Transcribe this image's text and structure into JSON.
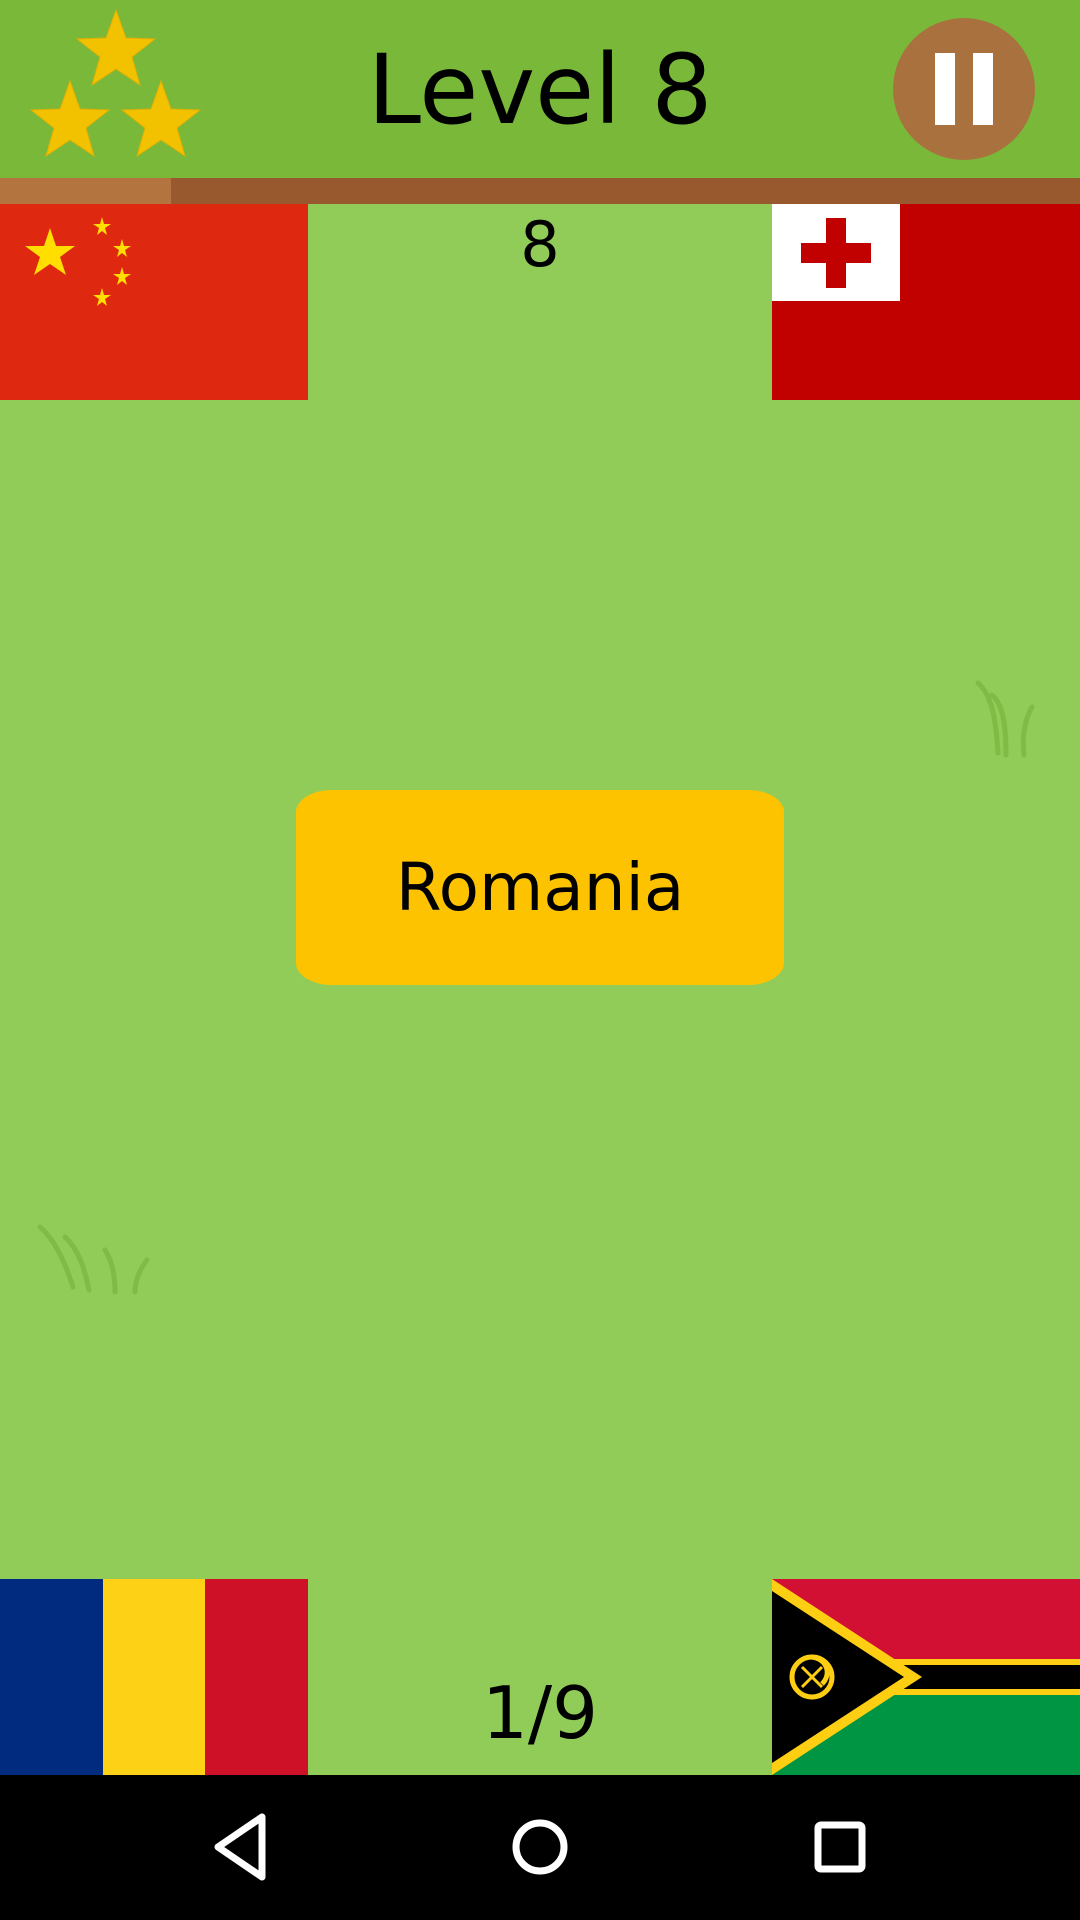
{
  "header": {
    "level_title": "Level 8",
    "stars_earned": 3,
    "star_color": "#f2c200",
    "pause_icon": "pause-icon"
  },
  "progress": {
    "fraction": 0.158,
    "track_color": "#98592e",
    "fill_color": "#b37440"
  },
  "game": {
    "score": "8",
    "question": "Romania",
    "counter": "1/9",
    "flags": [
      {
        "position": "top-left",
        "country_flag": "china-flag-icon"
      },
      {
        "position": "top-right",
        "country_flag": "tonga-flag-icon"
      },
      {
        "position": "bottom-left",
        "country_flag": "romania-flag-icon"
      },
      {
        "position": "bottom-right",
        "country_flag": "vanuatu-flag-icon"
      }
    ]
  },
  "navbar": {
    "back_icon": "back-triangle-icon",
    "home_icon": "home-circle-icon",
    "recent_icon": "recent-apps-square-icon"
  },
  "colors": {
    "background": "#92cc58",
    "header": "#7ab83a",
    "card": "#fdc300",
    "pause_button": "#a9713e"
  }
}
